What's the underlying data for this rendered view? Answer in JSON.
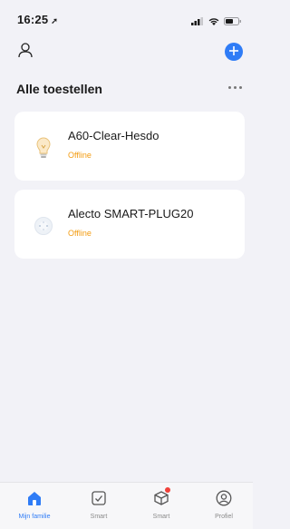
{
  "status_bar": {
    "time": "16:25",
    "location_arrow": "➚"
  },
  "header": {
    "profile_icon": "person-outline-icon",
    "add_icon": "plus-circle-icon"
  },
  "main": {
    "title": "Alle toestellen",
    "more_icon": "more-dots-icon"
  },
  "devices": [
    {
      "name": "A60-Clear-Hesdo",
      "status": "Offline",
      "icon": "light-bulb-icon"
    },
    {
      "name": "Alecto SMART-PLUG20",
      "status": "Offline",
      "icon": "smart-plug-icon"
    }
  ],
  "tabs": [
    {
      "label": "Mijn familie",
      "icon": "home-icon",
      "active": true
    },
    {
      "label": "Smart",
      "icon": "checkbox-icon",
      "active": false
    },
    {
      "label": "Smart",
      "icon": "cube-icon",
      "active": false
    },
    {
      "label": "Profiel",
      "icon": "profile-circle-icon",
      "active": false
    }
  ],
  "colors": {
    "accent": "#2f7cf6",
    "offline": "#f39c12",
    "badge": "#f0413a"
  }
}
